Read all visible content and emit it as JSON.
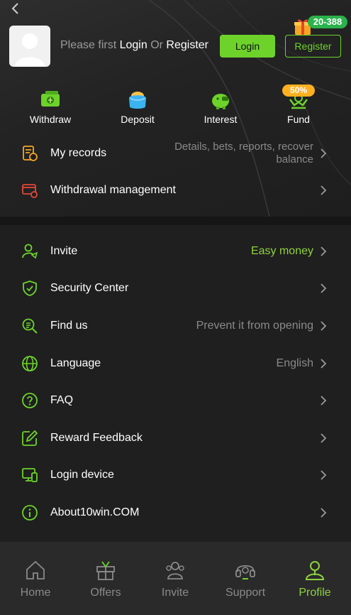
{
  "header": {
    "gift_count": "20-388",
    "login_prompt": {
      "prefix": "Please first ",
      "login": "Login",
      "or": " Or ",
      "register": "Register"
    },
    "login_button": "Login",
    "register_button": "Register"
  },
  "quick_actions": [
    {
      "label": "Withdraw",
      "icon": "withdraw-icon"
    },
    {
      "label": "Deposit",
      "icon": "wallet-icon"
    },
    {
      "label": "Interest",
      "icon": "piggy-bank-icon"
    },
    {
      "label": "Fund",
      "icon": "fund-icon",
      "badge": "50%"
    }
  ],
  "menu_top": [
    {
      "label": "My records",
      "value": "Details, bets, reports, recover balance",
      "icon": "records-icon"
    },
    {
      "label": "Withdrawal management",
      "value": "",
      "icon": "card-settings-icon"
    }
  ],
  "menu_main": [
    {
      "label": "Invite",
      "value": "Easy money",
      "icon": "invite-user-icon"
    },
    {
      "label": "Security Center",
      "value": "",
      "icon": "shield-check-icon"
    },
    {
      "label": "Find us",
      "value": "Prevent it from opening",
      "icon": "search-document-icon"
    },
    {
      "label": "Language",
      "value": "English",
      "icon": "globe-icon"
    },
    {
      "label": "FAQ",
      "value": "",
      "icon": "question-icon"
    },
    {
      "label": "Reward Feedback",
      "value": "",
      "icon": "edit-icon"
    },
    {
      "label": "Login device",
      "value": "",
      "icon": "devices-icon"
    },
    {
      "label": "About10win.COM",
      "value": "",
      "icon": "info-icon"
    }
  ],
  "tabs": [
    {
      "label": "Home",
      "icon": "home-icon"
    },
    {
      "label": "Offers",
      "icon": "gift-icon"
    },
    {
      "label": "Invite",
      "icon": "people-icon"
    },
    {
      "label": "Support",
      "icon": "headset-icon"
    },
    {
      "label": "Profile",
      "icon": "profile-icon",
      "active": true
    }
  ],
  "colors": {
    "accent": "#6dd32b",
    "accent_text": "#8ed33e",
    "badge_green": "#2bb24c",
    "badge_orange": "#ffb020"
  }
}
